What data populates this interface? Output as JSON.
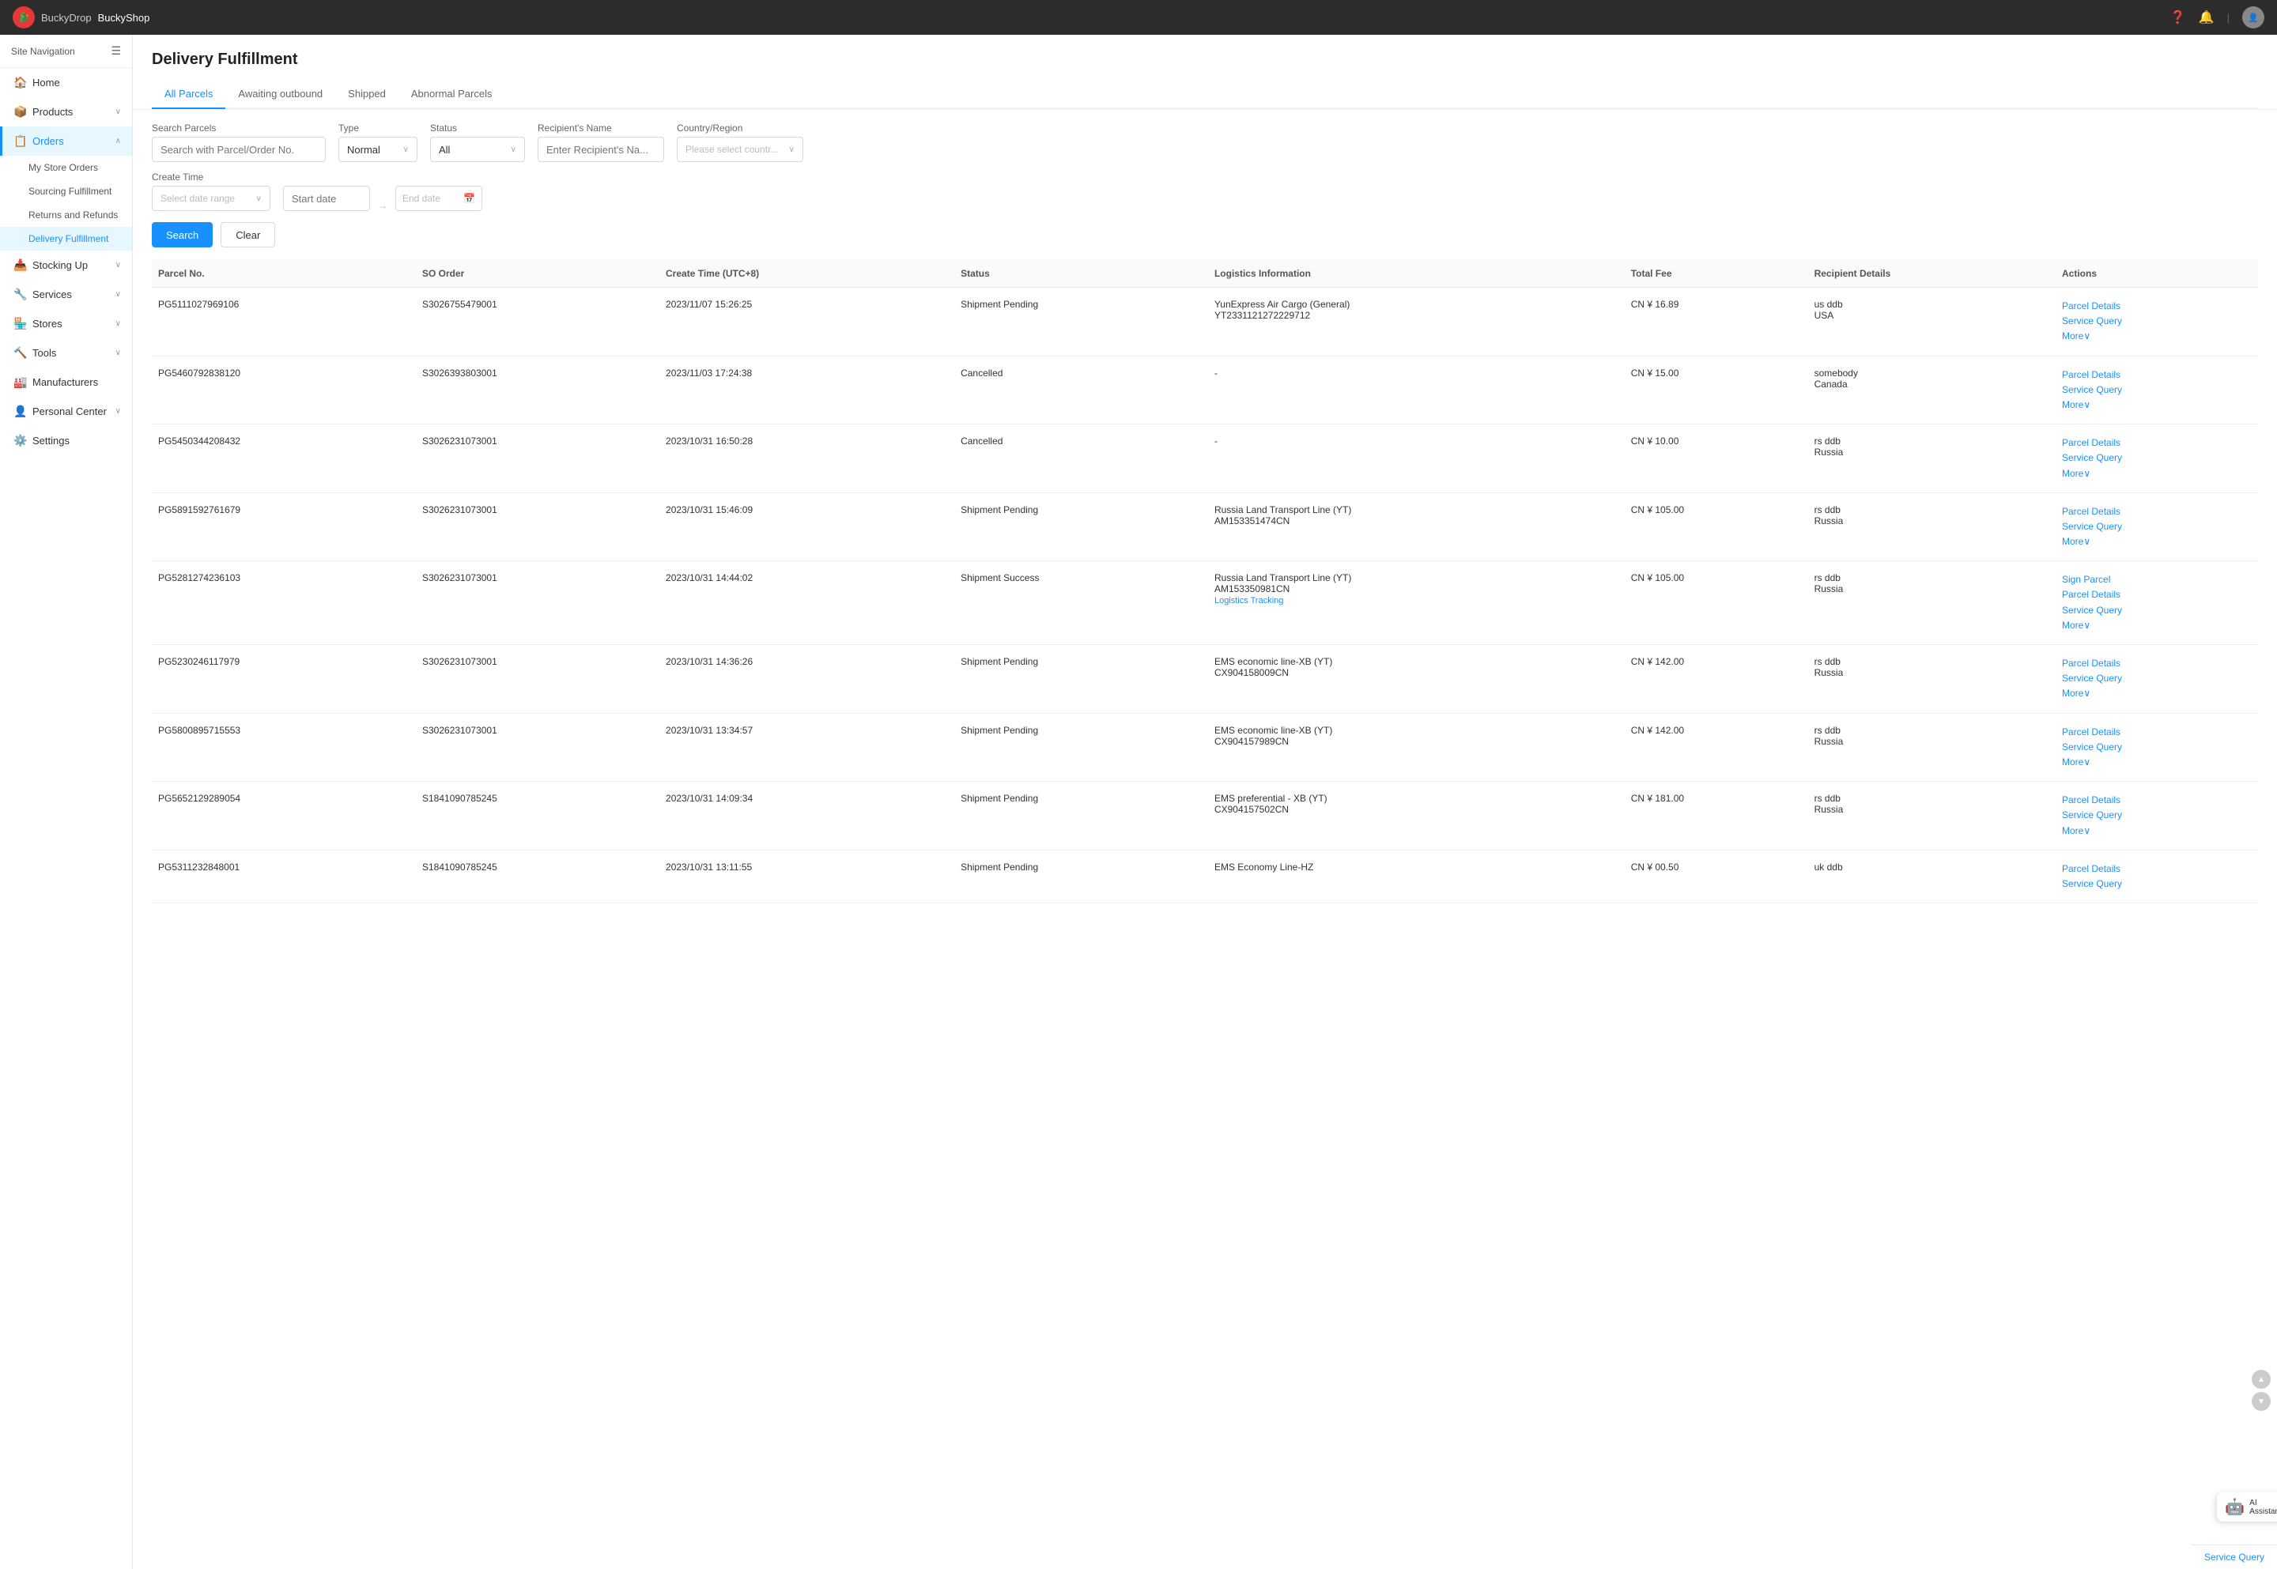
{
  "topbar": {
    "app_name": "BuckyDrop",
    "brand": "BuckyShop",
    "logo_text": "B"
  },
  "sidebar": {
    "header": "Site Navigation",
    "items": [
      {
        "id": "home",
        "label": "Home",
        "icon": "🏠",
        "has_arrow": false,
        "active": false
      },
      {
        "id": "products",
        "label": "Products",
        "icon": "📦",
        "has_arrow": true,
        "active": false
      },
      {
        "id": "orders",
        "label": "Orders",
        "icon": "📋",
        "has_arrow": true,
        "active": true
      },
      {
        "id": "stocking-up",
        "label": "Stocking Up",
        "icon": "📥",
        "has_arrow": true,
        "active": false
      },
      {
        "id": "services",
        "label": "Services",
        "icon": "🔧",
        "has_arrow": true,
        "active": false
      },
      {
        "id": "stores",
        "label": "Stores",
        "icon": "🏪",
        "has_arrow": true,
        "active": false
      },
      {
        "id": "tools",
        "label": "Tools",
        "icon": "🔨",
        "has_arrow": true,
        "active": false
      },
      {
        "id": "manufacturers",
        "label": "Manufacturers",
        "icon": "🏭",
        "has_arrow": false,
        "active": false
      },
      {
        "id": "personal-center",
        "label": "Personal Center",
        "icon": "👤",
        "has_arrow": true,
        "active": false
      },
      {
        "id": "settings",
        "label": "Settings",
        "icon": "⚙️",
        "has_arrow": false,
        "active": false
      }
    ],
    "sub_items_orders": [
      {
        "id": "my-store-orders",
        "label": "My Store Orders",
        "active": false
      },
      {
        "id": "sourcing-fulfillment",
        "label": "Sourcing Fulfillment",
        "active": false
      },
      {
        "id": "returns-refunds",
        "label": "Returns and Refunds",
        "active": false
      },
      {
        "id": "delivery-fulfillment",
        "label": "Delivery Fulfillment",
        "active": true
      }
    ]
  },
  "page": {
    "title": "Delivery Fulfillment"
  },
  "tabs": [
    {
      "id": "all-parcels",
      "label": "All Parcels",
      "active": true
    },
    {
      "id": "awaiting-outbound",
      "label": "Awaiting outbound",
      "active": false
    },
    {
      "id": "shipped",
      "label": "Shipped",
      "active": false
    },
    {
      "id": "abnormal-parcels",
      "label": "Abnormal Parcels",
      "active": false
    }
  ],
  "search": {
    "search_parcels_label": "Search Parcels",
    "search_parcels_placeholder": "Search with Parcel/Order No.",
    "type_label": "Type",
    "type_value": "Normal",
    "status_label": "Status",
    "status_value": "All",
    "recipient_label": "Recipient's Name",
    "recipient_placeholder": "Enter Recipient's Na...",
    "country_label": "Country/Region",
    "country_placeholder": "Please select countr...",
    "create_time_label": "Create Time",
    "date_range_placeholder": "Select date range",
    "start_date": "Start date",
    "end_date": "End date",
    "search_btn": "Search",
    "clear_btn": "Clear"
  },
  "table": {
    "columns": [
      "Parcel No.",
      "SO Order",
      "Create Time (UTC+8)",
      "Status",
      "Logistics Information",
      "Total Fee",
      "Recipient Details",
      "Actions"
    ],
    "rows": [
      {
        "parcel_no": "PG5111027969106",
        "so_order": "S3026755479001",
        "create_time": "2023/11/07 15:26:25",
        "status": "Shipment Pending",
        "logistics": "YunExpress Air Cargo (General)\nYT2331121272229712",
        "logistics_tracking": false,
        "total_fee": "CN ¥ 16.89",
        "recipient": "us ddb\nUSA",
        "actions": [
          "Parcel Details",
          "Service Query",
          "More∨"
        ]
      },
      {
        "parcel_no": "PG5460792838120",
        "so_order": "S3026393803001",
        "create_time": "2023/11/03 17:24:38",
        "status": "Cancelled",
        "logistics": "-",
        "logistics_tracking": false,
        "total_fee": "CN ¥ 15.00",
        "recipient": "somebody\nCanada",
        "actions": [
          "Parcel Details",
          "Service Query",
          "More∨"
        ]
      },
      {
        "parcel_no": "PG5450344208432",
        "so_order": "S3026231073001",
        "create_time": "2023/10/31 16:50:28",
        "status": "Cancelled",
        "logistics": "-",
        "logistics_tracking": false,
        "total_fee": "CN ¥ 10.00",
        "recipient": "rs ddb\nRussia",
        "actions": [
          "Parcel Details",
          "Service Query",
          "More∨"
        ]
      },
      {
        "parcel_no": "PG5891592761679",
        "so_order": "S3026231073001",
        "create_time": "2023/10/31 15:46:09",
        "status": "Shipment Pending",
        "logistics": "Russia Land Transport Line (YT)\nAM153351474CN",
        "logistics_tracking": false,
        "total_fee": "CN ¥ 105.00",
        "recipient": "rs ddb\nRussia",
        "actions": [
          "Parcel Details",
          "Service Query",
          "More∨"
        ]
      },
      {
        "parcel_no": "PG5281274236103",
        "so_order": "S3026231073001",
        "create_time": "2023/10/31 14:44:02",
        "status": "Shipment Success",
        "logistics": "Russia Land Transport Line (YT)\nAM153350981CN",
        "logistics_tracking": true,
        "total_fee": "CN ¥ 105.00",
        "recipient": "rs ddb\nRussia",
        "actions": [
          "Sign Parcel",
          "Parcel Details",
          "Service Query",
          "More∨"
        ]
      },
      {
        "parcel_no": "PG5230246117979",
        "so_order": "S3026231073001",
        "create_time": "2023/10/31 14:36:26",
        "status": "Shipment Pending",
        "logistics": "EMS economic line-XB (YT)\nCX904158009CN",
        "logistics_tracking": false,
        "total_fee": "CN ¥ 142.00",
        "recipient": "rs ddb\nRussia",
        "actions": [
          "Parcel Details",
          "Service Query",
          "More∨"
        ]
      },
      {
        "parcel_no": "PG5800895715553",
        "so_order": "S3026231073001",
        "create_time": "2023/10/31 13:34:57",
        "status": "Shipment Pending",
        "logistics": "EMS economic line-XB (YT)\nCX904157989CN",
        "logistics_tracking": false,
        "total_fee": "CN ¥ 142.00",
        "recipient": "rs ddb\nRussia",
        "actions": [
          "Parcel Details",
          "Service Query",
          "More∨"
        ]
      },
      {
        "parcel_no": "PG5652129289054",
        "so_order": "S1841090785245",
        "create_time": "2023/10/31 14:09:34",
        "status": "Shipment Pending",
        "logistics": "EMS preferential - XB (YT)\nCX904157502CN",
        "logistics_tracking": false,
        "total_fee": "CN ¥ 181.00",
        "recipient": "rs ddb\nRussia",
        "actions": [
          "Parcel Details",
          "Service Query",
          "More∨"
        ]
      },
      {
        "parcel_no": "PG5311232848001",
        "so_order": "S1841090785245",
        "create_time": "2023/10/31 13:11:55",
        "status": "Shipment Pending",
        "logistics": "EMS Economy Line-HZ",
        "logistics_tracking": false,
        "total_fee": "CN ¥ 00.50",
        "recipient": "uk ddb",
        "actions": [
          "Parcel Details",
          "Service Query"
        ]
      }
    ]
  },
  "ai_assistant": {
    "label": "AI Assistant"
  },
  "bottom_service": {
    "label": "Service Query"
  }
}
